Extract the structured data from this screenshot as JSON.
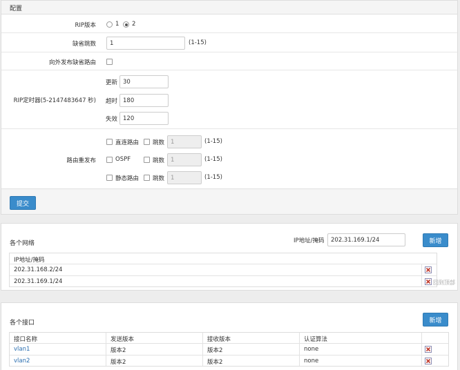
{
  "config": {
    "title": "配置",
    "rip_version": {
      "label": "RIP版本",
      "options": [
        "1",
        "2"
      ],
      "selected": "2"
    },
    "default_hops": {
      "label": "缺省跳数",
      "value": "1",
      "range": "(1-15)"
    },
    "advertise_default": {
      "label": "向外发布缺省路由"
    },
    "timers": {
      "label": "RIP定时器(5-2147483647 秒)",
      "update": {
        "label": "更新",
        "value": "30"
      },
      "timeout": {
        "label": "超时",
        "value": "180"
      },
      "flush": {
        "label": "失效",
        "value": "120"
      }
    },
    "redistribute": {
      "label": "路由重发布",
      "rows": [
        {
          "name": "直连路由",
          "hops_label": "跳数",
          "value": "1",
          "range": "(1-15)"
        },
        {
          "name": "OSPF",
          "hops_label": "跳数",
          "value": "1",
          "range": "(1-15)"
        },
        {
          "name": "静态路由",
          "hops_label": "跳数",
          "value": "1",
          "range": "(1-15)"
        }
      ]
    },
    "submit_label": "提交"
  },
  "networks": {
    "title": "各个网络",
    "ip_label": "IP地址/掩码",
    "ip_value": "202.31.169.1/24",
    "add_label": "新增",
    "header": "IP地址/掩码",
    "rows": [
      "202.31.168.2/24",
      "202.31.169.1/24"
    ],
    "back_to_top": "回到顶部"
  },
  "interfaces": {
    "title": "各个接口",
    "add_label": "新增",
    "headers": [
      "接口名称",
      "发送版本",
      "接收版本",
      "认证算法"
    ],
    "rows": [
      {
        "name": "vlan1",
        "send": "版本2",
        "recv": "版本2",
        "auth": "none"
      },
      {
        "name": "vlan2",
        "send": "版本2",
        "recv": "版本2",
        "auth": "none"
      }
    ]
  },
  "colors": {
    "primary": "#3a8ccb",
    "link": "#2a6eb0",
    "delete": "#c0392b"
  }
}
